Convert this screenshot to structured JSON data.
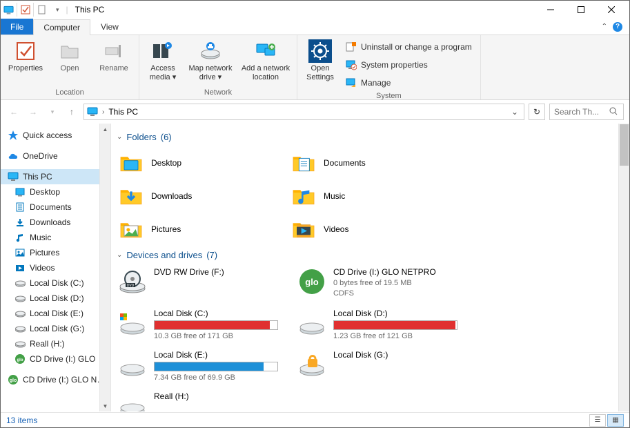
{
  "window": {
    "title": "This PC"
  },
  "tabs": {
    "file": "File",
    "computer": "Computer",
    "view": "View"
  },
  "ribbon": {
    "location": {
      "properties": "Properties",
      "open": "Open",
      "rename": "Rename",
      "group": "Location"
    },
    "network": {
      "access_media": "Access media",
      "map_drive": "Map network drive",
      "add_location": "Add a network location",
      "group": "Network"
    },
    "open_settings": "Open Settings",
    "system": {
      "uninstall": "Uninstall or change a program",
      "props": "System properties",
      "manage": "Manage",
      "group": "System"
    }
  },
  "address": {
    "location": "This PC"
  },
  "search": {
    "placeholder": "Search Th..."
  },
  "sidebar": {
    "quick_access": "Quick access",
    "onedrive": "OneDrive",
    "this_pc": "This PC",
    "children": [
      "Desktop",
      "Documents",
      "Downloads",
      "Music",
      "Pictures",
      "Videos",
      "Local Disk (C:)",
      "Local Disk (D:)",
      "Local Disk (E:)",
      "Local Disk (G:)",
      "Reall (H:)",
      "CD Drive (I:) GLO"
    ],
    "cd_drive_full": "CD Drive (I:) GLO NETPRO"
  },
  "sections": {
    "folders": {
      "title": "Folders",
      "count": "(6)",
      "items": [
        "Desktop",
        "Documents",
        "Downloads",
        "Music",
        "Pictures",
        "Videos"
      ]
    },
    "drives": {
      "title": "Devices and drives",
      "count": "(7)",
      "dvd": {
        "name": "DVD RW Drive (F:)"
      },
      "glo": {
        "name": "CD Drive (I:) GLO NETPRO",
        "stat": "0 bytes free of 19.5 MB",
        "fs": "CDFS"
      },
      "c": {
        "name": "Local Disk (C:)",
        "stat": "10.3 GB free of 171 GB",
        "fill": 94,
        "color": "#e03030"
      },
      "d": {
        "name": "Local Disk (D:)",
        "stat": "1.23 GB free of 121 GB",
        "fill": 99,
        "color": "#e03030"
      },
      "e": {
        "name": "Local Disk (E:)",
        "stat": "7.34 GB free of 69.9 GB",
        "fill": 89,
        "color": "#1e90d8"
      },
      "g": {
        "name": "Local Disk (G:)"
      },
      "h": {
        "name": "Reall (H:)"
      }
    }
  },
  "status": {
    "items": "13 items"
  }
}
